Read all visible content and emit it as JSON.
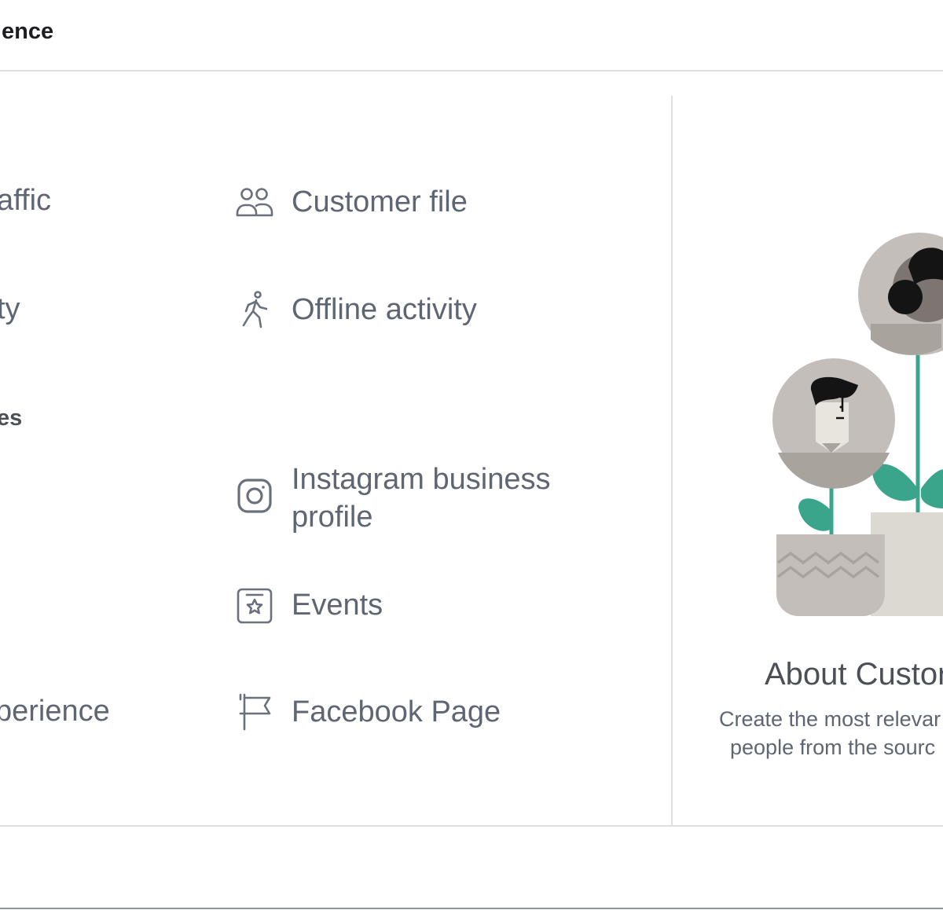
{
  "header": {
    "title": "ience"
  },
  "left_column": {
    "item1": "affic",
    "item2": "ty",
    "section_heading": "es",
    "item3": "perience"
  },
  "sources": [
    {
      "label": "Customer file",
      "icon": "people-icon"
    },
    {
      "label": "Offline activity",
      "icon": "walking-person-icon"
    },
    {
      "label_line1": "Instagram business",
      "label_line2": "profile",
      "icon": "instagram-icon"
    },
    {
      "label": "Events",
      "icon": "event-star-icon"
    },
    {
      "label": "Facebook Page",
      "icon": "flag-icon"
    }
  ],
  "about": {
    "title": "About Custor",
    "line1": "Create the most relevar",
    "line2": "people from the sourc"
  },
  "colors": {
    "accent_green": "#3aa58a",
    "text_gray": "#5f6673",
    "divider": "#dddfe2"
  }
}
